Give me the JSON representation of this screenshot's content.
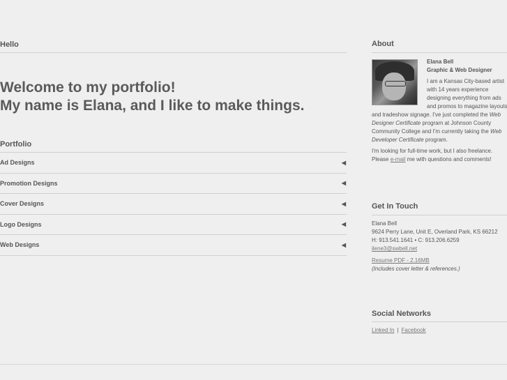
{
  "hello": {
    "heading": "Hello",
    "welcome_line1": "Welcome to my portfolio!",
    "welcome_line2": "My name is Elana, and I like to make things."
  },
  "portfolio": {
    "heading": "Portfolio",
    "arrow_icon": "triangle-left-icon",
    "items": [
      {
        "label": "Ad Designs"
      },
      {
        "label": "Promotion Designs"
      },
      {
        "label": "Cover Designs"
      },
      {
        "label": "Logo Designs"
      },
      {
        "label": "Web Designs"
      }
    ]
  },
  "about": {
    "heading": "About",
    "name": "Elana Bell",
    "title": "Graphic & Web Designer",
    "bio_1": "I am a Kansas City-based artist with 14 years experience designing everything from ads and promos to magazine layouts and tradeshow signage. I've just completed the ",
    "bio_cert1": "Web Designer Certificate",
    "bio_2": " program at Johnson County Community College and I'm currently taking the ",
    "bio_cert2": "Web Developer Certificate",
    "bio_3": " program.",
    "freelance_1": "I'm looking for full-time work, but I also freelance. Please ",
    "freelance_link": "e-mail",
    "freelance_2": " me with questions and comments!"
  },
  "contact": {
    "heading": "Get In Touch",
    "name": "Elana Bell",
    "address": "9624 Perry Lane, Unit E, Overland Park, KS 66212",
    "phones": "H: 913.541.1641 • C: 913.206.6259",
    "email": "ilene3@swbell.net",
    "resume_link": "Resume PDF - 2.16MB",
    "resume_note": "(Includes cover letter & references.)"
  },
  "social": {
    "heading": "Social Networks",
    "links": [
      {
        "label": "Linked In"
      },
      {
        "label": "Facebook"
      }
    ],
    "separator": "|"
  }
}
